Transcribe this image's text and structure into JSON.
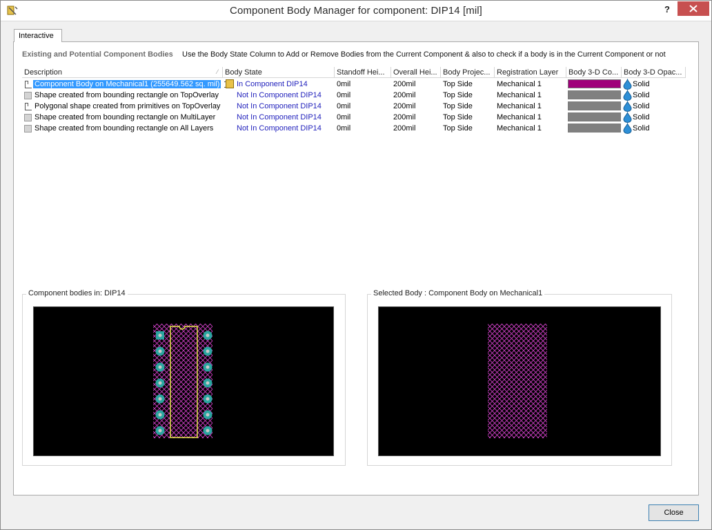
{
  "window": {
    "title": "Component Body Manager for component: DIP14 [mil]",
    "help_label": "?",
    "icons": {
      "app": "component-body-manager-icon",
      "close": "close-icon"
    },
    "accent_close": "#c75050"
  },
  "tab": {
    "label": "Interactive"
  },
  "section": {
    "title": "Existing and Potential Component Bodies",
    "hint": "Use the Body State Column to Add or Remove Bodies from the Current Component & also to check if a body is in the Current Component or not"
  },
  "table": {
    "headers": {
      "description": "Description",
      "state": "Body State",
      "standoff": "Standoff Hei...",
      "overall": "Overall Hei...",
      "projection": "Body Projec...",
      "layer": "Registration Layer",
      "color": "Body 3-D Co...",
      "opacity": "Body 3-D Opac..."
    },
    "rows": [
      {
        "description": "Component Body on Mechanical1 (255649.562 sq. mil)",
        "state": "In Component DIP14",
        "standoff": "0mil",
        "overall": "200mil",
        "projection": "Top Side",
        "layer": "Mechanical 1",
        "color": "#a0007a",
        "opacity": "Solid",
        "selected": true,
        "icon": "body-outline-icon"
      },
      {
        "description": "Shape created from bounding rectangle on TopOverlay",
        "state": "Not In Component DIP14",
        "standoff": "0mil",
        "overall": "200mil",
        "projection": "Top Side",
        "layer": "Mechanical 1",
        "color": "#808080",
        "opacity": "Solid",
        "selected": false,
        "icon": "shape-icon"
      },
      {
        "description": "Polygonal shape created from primitives on TopOverlay",
        "state": "Not In Component DIP14",
        "standoff": "0mil",
        "overall": "200mil",
        "projection": "Top Side",
        "layer": "Mechanical 1",
        "color": "#808080",
        "opacity": "Solid",
        "selected": false,
        "icon": "polygon-outline-icon"
      },
      {
        "description": "Shape created from bounding rectangle on MultiLayer",
        "state": "Not In Component DIP14",
        "standoff": "0mil",
        "overall": "200mil",
        "projection": "Top Side",
        "layer": "Mechanical 1",
        "color": "#808080",
        "opacity": "Solid",
        "selected": false,
        "icon": "shape-icon"
      },
      {
        "description": "Shape created from bounding rectangle on All Layers",
        "state": "Not In Component DIP14",
        "standoff": "0mil",
        "overall": "200mil",
        "projection": "Top Side",
        "layer": "Mechanical 1",
        "color": "#808080",
        "opacity": "Solid",
        "selected": false,
        "icon": "shape-icon"
      }
    ]
  },
  "panels": {
    "left_title": "Component bodies in: DIP14",
    "right_title": "Selected Body : Component Body on Mechanical1"
  },
  "buttons": {
    "close": "Close"
  },
  "colors": {
    "body_hatch": "#d040c8",
    "pad": "#2aa5a0",
    "outline": "#e8e84a",
    "selection": "#3399ff",
    "state_text": "#1d1dbb"
  }
}
